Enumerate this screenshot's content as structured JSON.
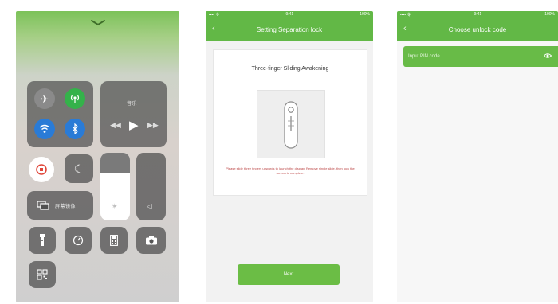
{
  "screens": {
    "control_center": {
      "media_tile_label": "音乐",
      "screen_mirroring_label": "屏幕镜像"
    },
    "separation_lock": {
      "status_bar": {
        "carrier": "•••• 令",
        "time": "9:41",
        "battery": "100%"
      },
      "nav": {
        "back_icon": "chevron-left",
        "title": "Setting Separation lock"
      },
      "card": {
        "heading": "Three-finger Sliding Awakening",
        "description": "Please slide three fingers upwards to launch the display. Remove single slide, then lock the screen to complete."
      },
      "next_button_label": "Next"
    },
    "unlock": {
      "status_bar": {
        "carrier": "•••• 令",
        "time": "9:41",
        "battery": "100%"
      },
      "nav": {
        "back_icon": "chevron-left",
        "title": "Choose unlock code"
      },
      "row": {
        "label": "Input PIN code",
        "icon": "eye-icon"
      }
    }
  },
  "colors": {
    "green": "#62b846",
    "button_green": "#6bbd45",
    "tile_dark": "#505050",
    "wifi_blue": "#2a7bd6",
    "radio_green": "#34b24a"
  }
}
